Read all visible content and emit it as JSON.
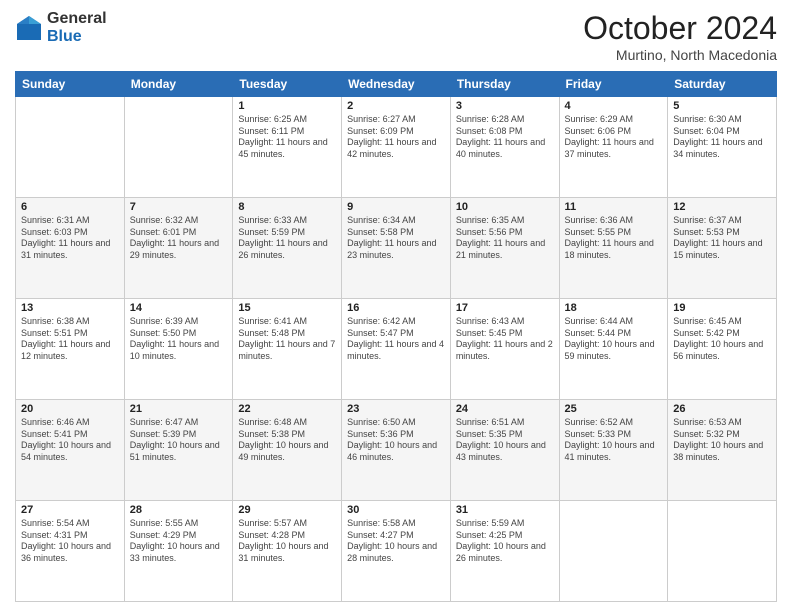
{
  "header": {
    "logo_general": "General",
    "logo_blue": "Blue",
    "month_title": "October 2024",
    "location": "Murtino, North Macedonia"
  },
  "days_of_week": [
    "Sunday",
    "Monday",
    "Tuesday",
    "Wednesday",
    "Thursday",
    "Friday",
    "Saturday"
  ],
  "weeks": [
    [
      {
        "day": "",
        "sunrise": "",
        "sunset": "",
        "daylight": ""
      },
      {
        "day": "",
        "sunrise": "",
        "sunset": "",
        "daylight": ""
      },
      {
        "day": "1",
        "sunrise": "Sunrise: 6:25 AM",
        "sunset": "Sunset: 6:11 PM",
        "daylight": "Daylight: 11 hours and 45 minutes."
      },
      {
        "day": "2",
        "sunrise": "Sunrise: 6:27 AM",
        "sunset": "Sunset: 6:09 PM",
        "daylight": "Daylight: 11 hours and 42 minutes."
      },
      {
        "day": "3",
        "sunrise": "Sunrise: 6:28 AM",
        "sunset": "Sunset: 6:08 PM",
        "daylight": "Daylight: 11 hours and 40 minutes."
      },
      {
        "day": "4",
        "sunrise": "Sunrise: 6:29 AM",
        "sunset": "Sunset: 6:06 PM",
        "daylight": "Daylight: 11 hours and 37 minutes."
      },
      {
        "day": "5",
        "sunrise": "Sunrise: 6:30 AM",
        "sunset": "Sunset: 6:04 PM",
        "daylight": "Daylight: 11 hours and 34 minutes."
      }
    ],
    [
      {
        "day": "6",
        "sunrise": "Sunrise: 6:31 AM",
        "sunset": "Sunset: 6:03 PM",
        "daylight": "Daylight: 11 hours and 31 minutes."
      },
      {
        "day": "7",
        "sunrise": "Sunrise: 6:32 AM",
        "sunset": "Sunset: 6:01 PM",
        "daylight": "Daylight: 11 hours and 29 minutes."
      },
      {
        "day": "8",
        "sunrise": "Sunrise: 6:33 AM",
        "sunset": "Sunset: 5:59 PM",
        "daylight": "Daylight: 11 hours and 26 minutes."
      },
      {
        "day": "9",
        "sunrise": "Sunrise: 6:34 AM",
        "sunset": "Sunset: 5:58 PM",
        "daylight": "Daylight: 11 hours and 23 minutes."
      },
      {
        "day": "10",
        "sunrise": "Sunrise: 6:35 AM",
        "sunset": "Sunset: 5:56 PM",
        "daylight": "Daylight: 11 hours and 21 minutes."
      },
      {
        "day": "11",
        "sunrise": "Sunrise: 6:36 AM",
        "sunset": "Sunset: 5:55 PM",
        "daylight": "Daylight: 11 hours and 18 minutes."
      },
      {
        "day": "12",
        "sunrise": "Sunrise: 6:37 AM",
        "sunset": "Sunset: 5:53 PM",
        "daylight": "Daylight: 11 hours and 15 minutes."
      }
    ],
    [
      {
        "day": "13",
        "sunrise": "Sunrise: 6:38 AM",
        "sunset": "Sunset: 5:51 PM",
        "daylight": "Daylight: 11 hours and 12 minutes."
      },
      {
        "day": "14",
        "sunrise": "Sunrise: 6:39 AM",
        "sunset": "Sunset: 5:50 PM",
        "daylight": "Daylight: 11 hours and 10 minutes."
      },
      {
        "day": "15",
        "sunrise": "Sunrise: 6:41 AM",
        "sunset": "Sunset: 5:48 PM",
        "daylight": "Daylight: 11 hours and 7 minutes."
      },
      {
        "day": "16",
        "sunrise": "Sunrise: 6:42 AM",
        "sunset": "Sunset: 5:47 PM",
        "daylight": "Daylight: 11 hours and 4 minutes."
      },
      {
        "day": "17",
        "sunrise": "Sunrise: 6:43 AM",
        "sunset": "Sunset: 5:45 PM",
        "daylight": "Daylight: 11 hours and 2 minutes."
      },
      {
        "day": "18",
        "sunrise": "Sunrise: 6:44 AM",
        "sunset": "Sunset: 5:44 PM",
        "daylight": "Daylight: 10 hours and 59 minutes."
      },
      {
        "day": "19",
        "sunrise": "Sunrise: 6:45 AM",
        "sunset": "Sunset: 5:42 PM",
        "daylight": "Daylight: 10 hours and 56 minutes."
      }
    ],
    [
      {
        "day": "20",
        "sunrise": "Sunrise: 6:46 AM",
        "sunset": "Sunset: 5:41 PM",
        "daylight": "Daylight: 10 hours and 54 minutes."
      },
      {
        "day": "21",
        "sunrise": "Sunrise: 6:47 AM",
        "sunset": "Sunset: 5:39 PM",
        "daylight": "Daylight: 10 hours and 51 minutes."
      },
      {
        "day": "22",
        "sunrise": "Sunrise: 6:48 AM",
        "sunset": "Sunset: 5:38 PM",
        "daylight": "Daylight: 10 hours and 49 minutes."
      },
      {
        "day": "23",
        "sunrise": "Sunrise: 6:50 AM",
        "sunset": "Sunset: 5:36 PM",
        "daylight": "Daylight: 10 hours and 46 minutes."
      },
      {
        "day": "24",
        "sunrise": "Sunrise: 6:51 AM",
        "sunset": "Sunset: 5:35 PM",
        "daylight": "Daylight: 10 hours and 43 minutes."
      },
      {
        "day": "25",
        "sunrise": "Sunrise: 6:52 AM",
        "sunset": "Sunset: 5:33 PM",
        "daylight": "Daylight: 10 hours and 41 minutes."
      },
      {
        "day": "26",
        "sunrise": "Sunrise: 6:53 AM",
        "sunset": "Sunset: 5:32 PM",
        "daylight": "Daylight: 10 hours and 38 minutes."
      }
    ],
    [
      {
        "day": "27",
        "sunrise": "Sunrise: 5:54 AM",
        "sunset": "Sunset: 4:31 PM",
        "daylight": "Daylight: 10 hours and 36 minutes."
      },
      {
        "day": "28",
        "sunrise": "Sunrise: 5:55 AM",
        "sunset": "Sunset: 4:29 PM",
        "daylight": "Daylight: 10 hours and 33 minutes."
      },
      {
        "day": "29",
        "sunrise": "Sunrise: 5:57 AM",
        "sunset": "Sunset: 4:28 PM",
        "daylight": "Daylight: 10 hours and 31 minutes."
      },
      {
        "day": "30",
        "sunrise": "Sunrise: 5:58 AM",
        "sunset": "Sunset: 4:27 PM",
        "daylight": "Daylight: 10 hours and 28 minutes."
      },
      {
        "day": "31",
        "sunrise": "Sunrise: 5:59 AM",
        "sunset": "Sunset: 4:25 PM",
        "daylight": "Daylight: 10 hours and 26 minutes."
      },
      {
        "day": "",
        "sunrise": "",
        "sunset": "",
        "daylight": ""
      },
      {
        "day": "",
        "sunrise": "",
        "sunset": "",
        "daylight": ""
      }
    ]
  ]
}
